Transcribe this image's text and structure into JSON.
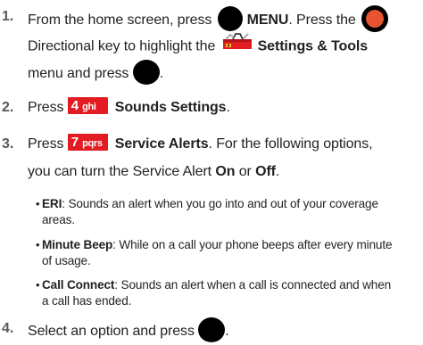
{
  "steps": [
    {
      "num": "1.",
      "l1_a": "From the home screen, press ",
      "l1_b": "MENU",
      "l1_c": ". Press the ",
      "l2_a": "Directional key to highlight the ",
      "l2_b": "Settings & Tools",
      "l3_a": "menu and press ",
      "l3_b": "."
    },
    {
      "num": "2.",
      "a": "Press ",
      "key_digit": "4",
      "key_letters": "ghi",
      "b": "Sounds Settings",
      "c": "."
    },
    {
      "num": "3.",
      "a": "Press ",
      "key_digit": "7",
      "key_letters": "pqrs",
      "b": "Service Alerts",
      "c": ". For the following options,",
      "l2_a": "you can turn the Service Alert ",
      "on": "On",
      "l2_b": " or ",
      "off": "Off",
      "l2_c": "."
    },
    {
      "num": "4.",
      "a": "Select an option and press ",
      "b": "."
    }
  ],
  "options": [
    {
      "term": "ERI",
      "l1": ": Sounds an alert when you go into and out of your coverage",
      "l2": "areas."
    },
    {
      "term": "Minute Beep",
      "l1": ": While on a call your phone beeps after every minute",
      "l2": "of usage."
    },
    {
      "term": "Call Connect",
      "l1": ": Sounds an alert when a call is connected and when",
      "l2": "a call has ended."
    }
  ],
  "colors": {
    "key_red": "#e31b23",
    "step_number": "#58595b",
    "directional_ring": "#e8542f"
  },
  "icons": {
    "menu_key": "ok-key-icon",
    "directional_key": "directional-key-icon",
    "settings_tools": "toolbox-icon"
  }
}
